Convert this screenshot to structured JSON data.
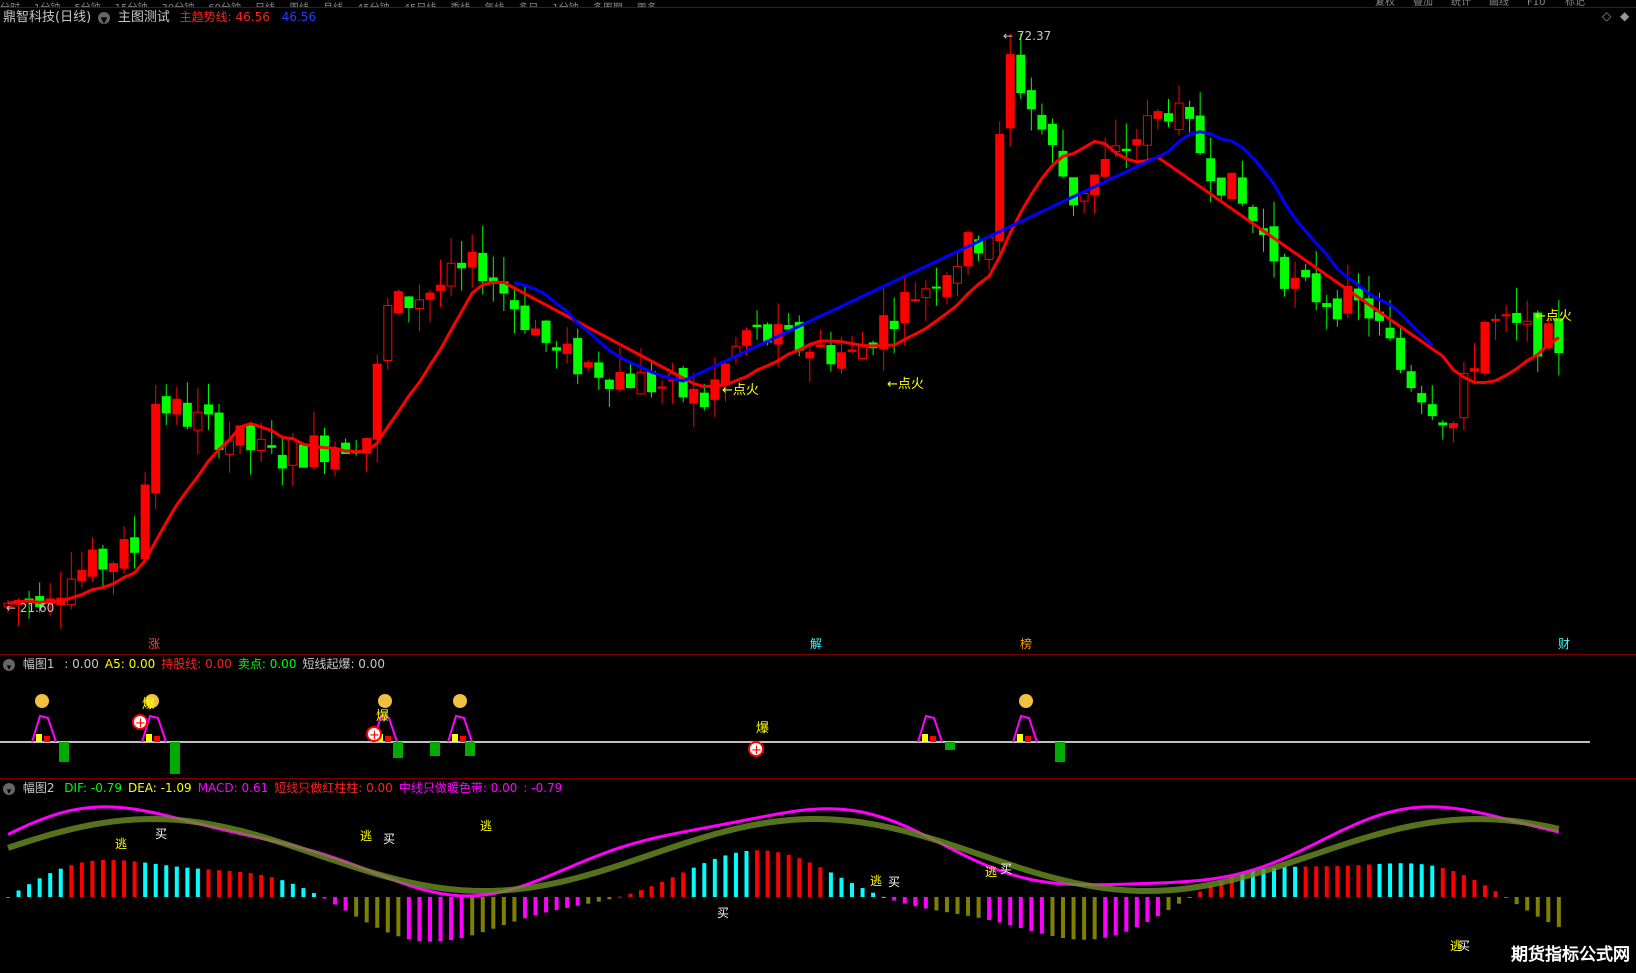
{
  "top_menu": [
    "分时",
    "1分钟",
    "5分钟",
    "15分钟",
    "30分钟",
    "60分钟",
    "日线",
    "周线",
    "月线",
    "45分钟",
    "45日线",
    "季线",
    "年线",
    "多日",
    "1分钟",
    "多周期",
    "更多"
  ],
  "right_menu": [
    "复权",
    "叠加",
    "统计",
    "画线",
    "F10",
    "标记"
  ],
  "main_panel": {
    "stock_name": "鼎智科技(日线)",
    "indicator_name": "主图测试",
    "trend_label": "主趋势线:",
    "trend_value1": "46.56",
    "trend_value2": "46.56",
    "high_label": "72.37",
    "low_label": "21.60",
    "ignite_label": "点火",
    "event_labels": [
      "涨",
      "解",
      "榜",
      "财"
    ]
  },
  "sub1": {
    "name": "幅图1",
    "fields": [
      {
        "label": "",
        "value": ": 0.00",
        "color": "#c8c8c8"
      },
      {
        "label": "A5:",
        "value": "0.00",
        "color": "#ffff00"
      },
      {
        "label": "持股线:",
        "value": "0.00",
        "color": "#ff2020"
      },
      {
        "label": "卖点:",
        "value": "0.00",
        "color": "#00ff00"
      },
      {
        "label": "短线起爆:",
        "value": "0.00",
        "color": "#c8c8c8"
      }
    ],
    "burst_label": "爆"
  },
  "sub2": {
    "name": "幅图2",
    "fields": [
      {
        "label": "DIF:",
        "value": "-0.79",
        "color": "#00ff00"
      },
      {
        "label": "DEA:",
        "value": "-1.09",
        "color": "#ffff00"
      },
      {
        "label": "MACD:",
        "value": "0.61",
        "color": "#ff00ff"
      },
      {
        "label": "短线只做红柱柱:",
        "value": "0.00",
        "color": "#ff2020"
      },
      {
        "label": "中线只做暖色带:",
        "value": "0.00",
        "color": "#ff00ff"
      },
      {
        "label": ":",
        "value": "-0.79",
        "color": "#ff00ff"
      }
    ],
    "buy_label": "买",
    "escape_label": "逃"
  },
  "watermark": "期货指标公式网",
  "colors": {
    "up": "#ff0000",
    "down": "#00ff00",
    "trend_up": "#ff0000",
    "trend_down": "#0000ff",
    "cyan": "#00ffff",
    "olive": "#808000",
    "magenta": "#ff00ff"
  }
}
